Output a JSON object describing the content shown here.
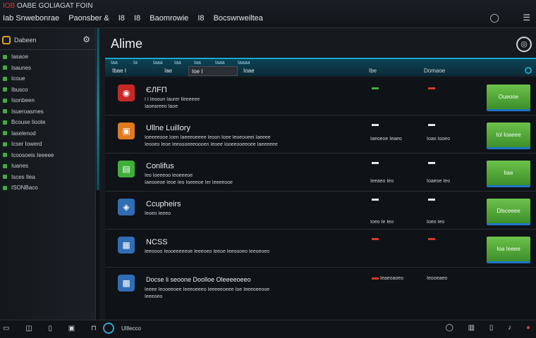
{
  "window": {
    "menu_hot": "IOB",
    "menu_text": "OABE GOLIAGAT FOIN",
    "tabs": [
      "Iab Snwebonrae",
      "Paonsber &",
      "I8",
      "I8",
      "Baomrowie",
      "I8",
      "Bocswrweiltea"
    ],
    "controls": [
      "◯",
      "☰"
    ]
  },
  "sidebar": {
    "header_label": "Dabeen",
    "header_icon": "gear-icon",
    "items": [
      "Iasaoe",
      "Isaunes",
      "Icoue",
      "Ibusco",
      "Isonbeen",
      "Isueroasmes",
      "Bcouse Iioote",
      "Iaselenod",
      "Icser Iowerd",
      "Icoosoeis Ieeeee",
      "Iuanes",
      "Isces Ilea",
      "ISONBaco"
    ]
  },
  "main": {
    "title": "Alime",
    "tabs": [
      "Iaa",
      "Ia",
      "Iaaa",
      "Iaa",
      "Iaa",
      "Iaaa",
      "Iaaaa"
    ],
    "filter_left": "Ibae I",
    "filter_mid": "Iae",
    "filter_mid2": "Ioae",
    "filter_box": "Ioe  I",
    "col1": "Ibe",
    "col2": "Domaoe",
    "rows": [
      {
        "name": "ЄЛFП",
        "d1": "I  I  Ieooun Iaurer  Ileeeeee",
        "d2": "Iaoeareeo  Iaoe",
        "c1": "",
        "c2": "",
        "c1_color": "#3fae3a",
        "c2_color": "#d43b2e",
        "button": "Oueooe",
        "icon": "shield-icon",
        "icon_color": "#c62828"
      },
      {
        "name": "Ullne Luillory",
        "d1": "Ioeeeeooe Ioen Iaeeeoeeee Ieoon Ioee Ieoeooeei Iaeeee",
        "d2": "Ieooeo Ieoe Ieeoooeeeoooen Ieoee Iooeeooeeoee Iaeeeeee",
        "c1": "Iaeoeoe Ieaeo",
        "c2": "Ioao Iooeo",
        "c1_color": "#e4e8ec",
        "c2_color": "#e4e8ec",
        "button": "Iol Ioaeee",
        "icon": "folder-icon",
        "icon_color": "#e07a1f"
      },
      {
        "name": "Conlifus",
        "d1": "Ieo Ioeeeoo Ieoeeeoe",
        "d2": "Iaeooeoe  Ieoe Ieo Ioeeeoe Ier Ieeeeooe",
        "c1": "Ieeaeo Ieo",
        "c2": "Ioaeoe Ieo",
        "c1_color": "#e4e8ec",
        "c2_color": "#e4e8ec",
        "button": "Iiae",
        "icon": "document-icon",
        "icon_color": "#3fae3a"
      },
      {
        "name": "Ccupheirs",
        "d1": "Ieoeo Ieeeo",
        "d2": "",
        "c1": "Ioeo Ie Ieo",
        "c2": "Ioeo Ieo",
        "c1_color": "#e4e8ec",
        "c2_color": "#e4e8ec",
        "button": "Dlsceeee",
        "icon": "disk-icon",
        "icon_color": "#2f6db5"
      },
      {
        "name": "NCSS",
        "d1": "Ieeoooo Ieooeeeeeoe Ieeeoeo Ieeoe Ieeoooeo Ieeoeoeo",
        "d2": "",
        "c1": "",
        "c2": "",
        "c1_color": "#d43b2e",
        "c2_color": "#d43b2e",
        "button": "Ioa Ieeee",
        "icon": "window-icon",
        "icon_color": "#2f6db5"
      },
      {
        "name": "Docse li seoone Doolloe Oleeeeoeeo",
        "d1": "Ieeee Ieooeeoee Ieeeoeeeo Ieeeeeoeee Ioe Ieeeoeeooe",
        "d2": "Ieeeoeo",
        "c1": "Ieaeoaoeo",
        "c2": "Ieooeaeo",
        "c1_color": "#d43b2e",
        "c2_color": "#e4e8ec",
        "button": "",
        "icon": "package-icon",
        "icon_color": "#2f6db5"
      }
    ]
  },
  "bottombar": {
    "left": [
      "▭",
      "◫",
      "▯",
      "▣",
      "⊓"
    ],
    "status": "Ulllecco",
    "right": [
      "◯",
      "▥",
      "▯",
      "♪",
      "●"
    ]
  }
}
